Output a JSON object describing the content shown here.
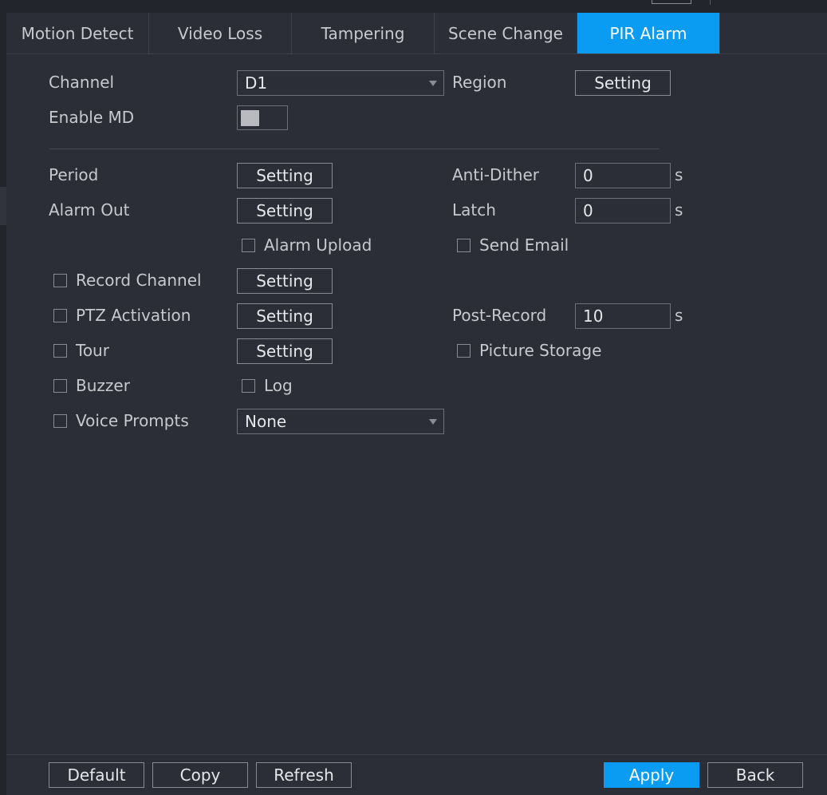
{
  "tabs": [
    {
      "label": "Motion Detect",
      "active": false
    },
    {
      "label": "Video Loss",
      "active": false
    },
    {
      "label": "Tampering",
      "active": false
    },
    {
      "label": "Scene Change",
      "active": false
    },
    {
      "label": "PIR Alarm",
      "active": true
    }
  ],
  "form": {
    "channel_label": "Channel",
    "channel_value": "D1",
    "region_label": "Region",
    "enable_md_label": "Enable MD",
    "enable_md_on": false,
    "period_label": "Period",
    "anti_dither_label": "Anti-Dither",
    "anti_dither_value": "0",
    "alarm_out_label": "Alarm Out",
    "latch_label": "Latch",
    "latch_value": "0",
    "alarm_upload_label": "Alarm Upload",
    "send_email_label": "Send Email",
    "record_channel_label": "Record Channel",
    "ptz_activation_label": "PTZ Activation",
    "post_record_label": "Post-Record",
    "post_record_value": "10",
    "tour_label": "Tour",
    "picture_storage_label": "Picture Storage",
    "buzzer_label": "Buzzer",
    "log_label": "Log",
    "voice_prompts_label": "Voice Prompts",
    "voice_prompts_value": "None",
    "setting_label": "Setting",
    "unit_seconds": "s"
  },
  "footer": {
    "default_label": "Default",
    "copy_label": "Copy",
    "refresh_label": "Refresh",
    "apply_label": "Apply",
    "back_label": "Back"
  },
  "colors": {
    "background": "#2b2d37",
    "accent": "#0a9cf2",
    "text": "#c8c9ce"
  }
}
